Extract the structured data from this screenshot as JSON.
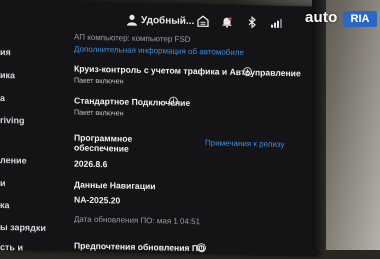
{
  "status_bar": {
    "user_name": "Удобный...",
    "icons": [
      "user-icon",
      "garage-icon",
      "bell-icon",
      "bluetooth-icon",
      "signal-icon"
    ]
  },
  "sidebar": {
    "items": [
      {
        "label": "ия"
      },
      {
        "label": "ика"
      },
      {
        "label": "а"
      },
      {
        "label": "riving"
      },
      {
        "label": "ление"
      },
      {
        "label": "и"
      },
      {
        "label": "ка"
      },
      {
        "label": "ы зарядки"
      },
      {
        "label": "сть и"
      }
    ]
  },
  "main": {
    "autopilot_computer": "АП компьютер: компьютер FSD",
    "more_info_link": "Дополнительная информация об автомобиле",
    "cruise_title": "Круиз-контроль с учетом трафика и Автоуправление",
    "cruise_status": "Пакет включен",
    "connectivity_title": "Стандартное Подключение",
    "connectivity_status": "Пакет включен",
    "software_label_line1": "Программное",
    "software_label_line2": "обеспечение",
    "release_notes_link": "Примечания к релизу",
    "software_version": "2026.8.6",
    "nav_data_label": "Данные Навигации",
    "nav_data_version": "NA-2025.20",
    "update_date": "Дата обновления ПО: мая 1 04:51",
    "update_pref_partial": "Предпочтения обновления ПО"
  },
  "watermark": {
    "text": "auto",
    "badge": "RIA"
  },
  "colors": {
    "screen_bg": "#141416",
    "link": "#3e8ee6",
    "text": "#f0f0f2",
    "watermark_badge": "#2b67c5"
  }
}
